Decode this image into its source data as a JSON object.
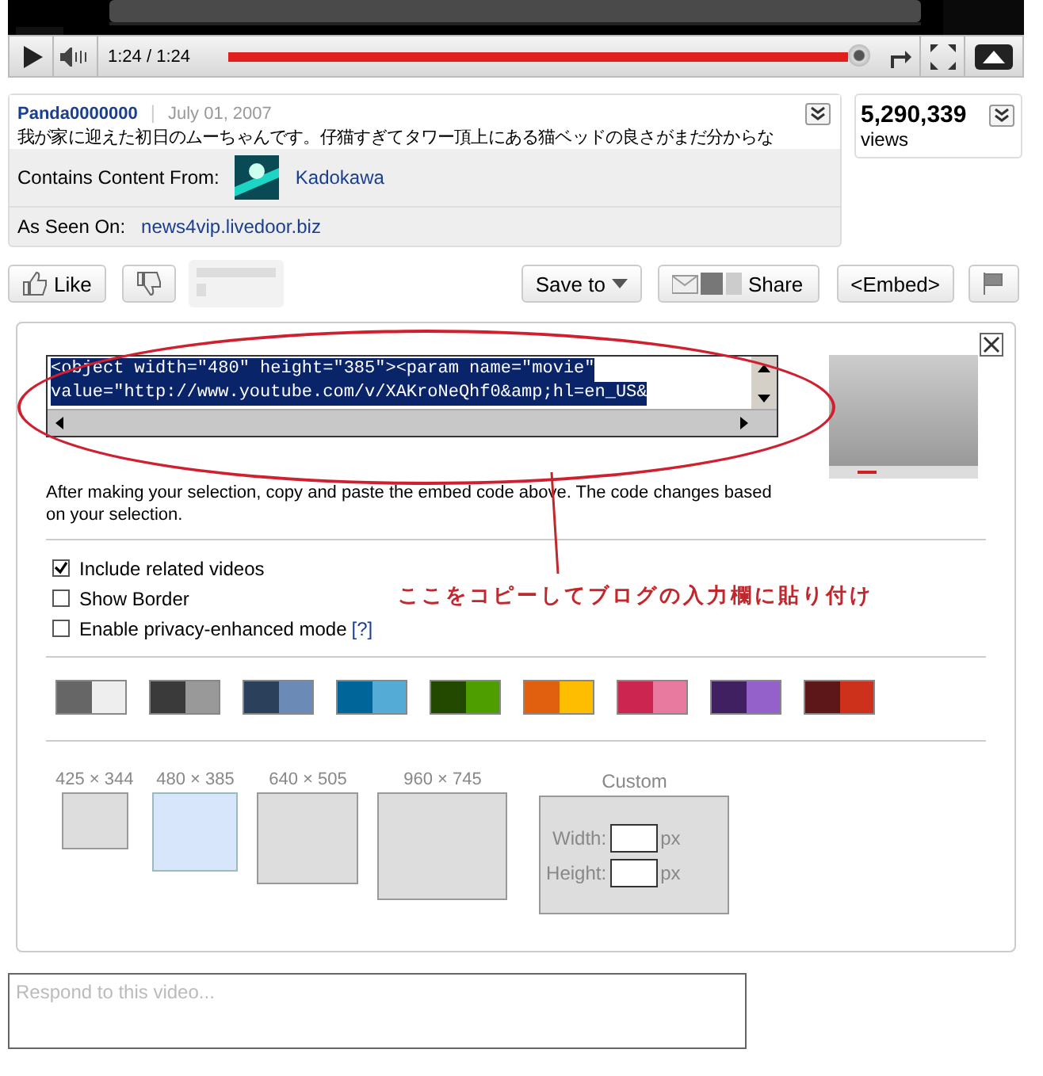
{
  "player": {
    "time": "1:24 / 1:24",
    "level": 1.0
  },
  "info": {
    "author": "Panda0000000",
    "separator": "|",
    "date": "July 01, 2007",
    "description": "我が家に迎えた初日のムーちゃんです。仔猫すぎてタワー頂上にある猫ベッドの良さがまだ分からな",
    "content_label": "Contains Content From:",
    "content_source": "Kadokawa",
    "seen_label": "As Seen On:",
    "seen_link": "news4vip.livedoor.biz"
  },
  "views": {
    "count": "5,290,339",
    "label": "views"
  },
  "actions": {
    "like": "Like",
    "save": "Save to",
    "share": "Share",
    "embed": "<Embed>"
  },
  "embed_panel": {
    "code_lines": [
      "<object width=\"480\" height=\"385\"><param name=\"movie\"",
      "value=\"http://www.youtube.com/v/XAKroNeQhf0&amp;hl=en_US&"
    ],
    "help": "After making your selection, copy and paste the embed code above. The code changes based on your selection.",
    "options": [
      {
        "label": "Include related videos",
        "checked": true
      },
      {
        "label": "Show Border",
        "checked": false
      },
      {
        "label": "Enable privacy-enhanced mode",
        "link": "[?]",
        "checked": false
      }
    ],
    "themes": [
      {
        "halves": [
          {
            "color": "#666666"
          },
          {
            "color": "#eeeeee"
          }
        ]
      },
      {
        "halves": [
          {
            "color": "#3a3a3a"
          },
          {
            "color": "#999999"
          }
        ]
      },
      {
        "halves": [
          {
            "color": "#2b405b"
          },
          {
            "color": "#6b8ab6"
          }
        ]
      },
      {
        "halves": [
          {
            "color": "#006699"
          },
          {
            "color": "#54abd6"
          }
        ]
      },
      {
        "halves": [
          {
            "color": "#234900"
          },
          {
            "color": "#4e9e00"
          }
        ]
      },
      {
        "halves": [
          {
            "color": "#e1600f"
          },
          {
            "color": "#febd01"
          }
        ]
      },
      {
        "halves": [
          {
            "color": "#cc2550"
          },
          {
            "color": "#e87a9f"
          }
        ]
      },
      {
        "halves": [
          {
            "color": "#402061"
          },
          {
            "color": "#9461ca"
          }
        ]
      },
      {
        "halves": [
          {
            "color": "#5d1719"
          },
          {
            "color": "#cd311b"
          }
        ]
      }
    ],
    "sizes": [
      {
        "label": "425 × 344",
        "selected": false
      },
      {
        "label": "480 × 385",
        "selected": true
      },
      {
        "label": "640 × 505",
        "selected": false
      },
      {
        "label": "960 × 745",
        "selected": false
      }
    ],
    "custom": {
      "title": "Custom",
      "width_label": "Width:",
      "height_label": "Height:",
      "unit": "px",
      "height_unit": "px"
    },
    "annotation": "ここをコピーしてブログの入力欄に貼り付け"
  },
  "response": {
    "placeholder": "Respond to this video..."
  }
}
